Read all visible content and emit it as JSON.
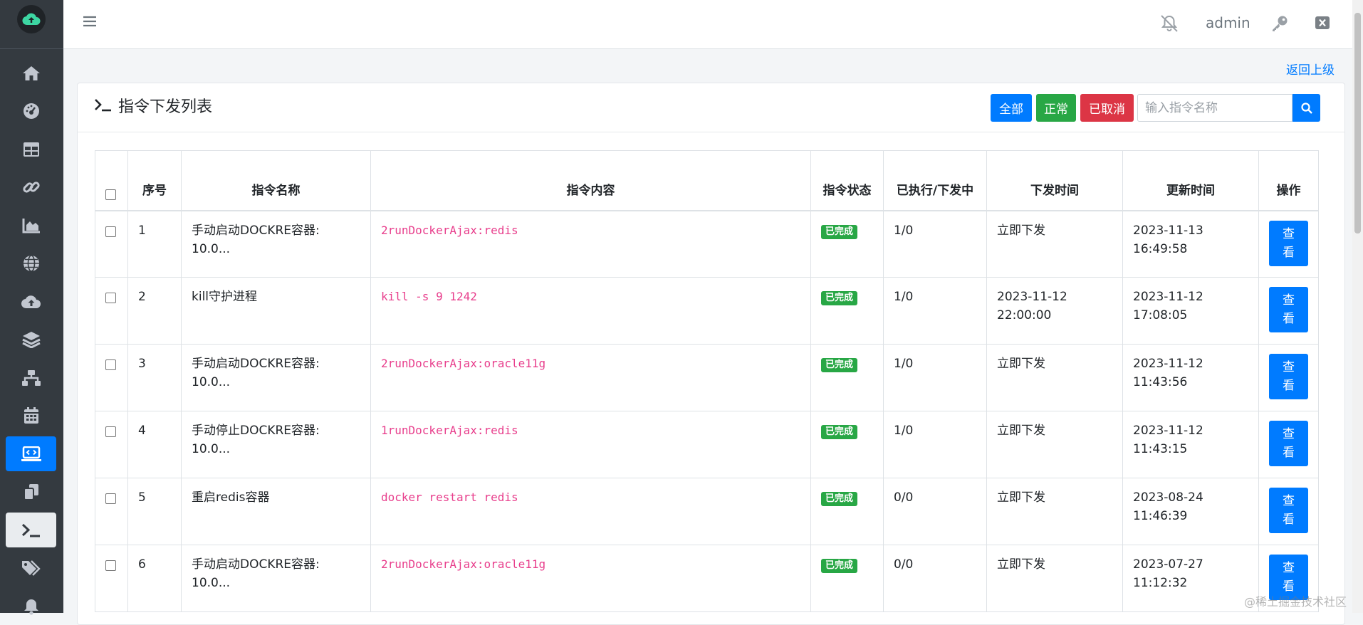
{
  "topbar": {
    "user": "admin"
  },
  "back_link": "返回上级",
  "card": {
    "title": "指令下发列表",
    "filters": {
      "all": "全部",
      "normal": "正常",
      "cancelled": "已取消"
    },
    "search_placeholder": "输入指令名称"
  },
  "table": {
    "headers": {
      "index": "序号",
      "name": "指令名称",
      "content": "指令内容",
      "status": "指令状态",
      "executed": "已执行/下发中",
      "send_time": "下发时间",
      "update_time": "更新时间",
      "action": "操作"
    },
    "rows": [
      {
        "index": "1",
        "name_l1": "手动启动DOCKRE容器:",
        "name_l2": "10.0...",
        "content": "2runDockerAjax:redis",
        "status": "已完成",
        "executed": "1/0",
        "send_l1": "立即下发",
        "send_l2": "",
        "upd_l1": "2023-11-13",
        "upd_l2": "16:49:58",
        "btn_l1": "查",
        "btn_l2": "看"
      },
      {
        "index": "2",
        "name_l1": "kill守护进程",
        "name_l2": "",
        "content": "kill -s 9 1242",
        "status": "已完成",
        "executed": "1/0",
        "send_l1": "2023-11-12",
        "send_l2": "22:00:00",
        "upd_l1": "2023-11-12",
        "upd_l2": "17:08:05",
        "btn_l1": "查",
        "btn_l2": "看"
      },
      {
        "index": "3",
        "name_l1": "手动启动DOCKRE容器:",
        "name_l2": "10.0...",
        "content": "2runDockerAjax:oracle11g",
        "status": "已完成",
        "executed": "1/0",
        "send_l1": "立即下发",
        "send_l2": "",
        "upd_l1": "2023-11-12",
        "upd_l2": "11:43:56",
        "btn_l1": "查",
        "btn_l2": "看"
      },
      {
        "index": "4",
        "name_l1": "手动停止DOCKRE容器:",
        "name_l2": "10.0...",
        "content": "1runDockerAjax:redis",
        "status": "已完成",
        "executed": "1/0",
        "send_l1": "立即下发",
        "send_l2": "",
        "upd_l1": "2023-11-12",
        "upd_l2": "11:43:15",
        "btn_l1": "查",
        "btn_l2": "看"
      },
      {
        "index": "5",
        "name_l1": "重启redis容器",
        "name_l2": "",
        "content": "docker restart redis",
        "status": "已完成",
        "executed": "0/0",
        "send_l1": "立即下发",
        "send_l2": "",
        "upd_l1": "2023-08-24",
        "upd_l2": "11:46:39",
        "btn_l1": "查",
        "btn_l2": "看"
      },
      {
        "index": "6",
        "name_l1": "手动启动DOCKRE容器:",
        "name_l2": "10.0...",
        "content": "2runDockerAjax:oracle11g",
        "status": "已完成",
        "executed": "0/0",
        "send_l1": "立即下发",
        "send_l2": "",
        "upd_l1": "2023-07-27",
        "upd_l2": "11:12:32",
        "btn_l1": "查",
        "btn_l2": "看"
      }
    ]
  },
  "watermark": "@稀土掘金技术社区",
  "colors": {
    "sidebar": "#343a40",
    "primary": "#007bff",
    "success": "#28a745",
    "danger": "#dc3545",
    "code": "#e83e8c"
  },
  "icons": [
    "cloud-upload-icon",
    "home-icon",
    "dashboard-icon",
    "table-icon",
    "link-icon",
    "chart-area-icon",
    "globe-icon",
    "cloud-upload-icon",
    "layers-icon",
    "sitemap-icon",
    "calendar-icon",
    "laptop-code-icon",
    "copy-icon",
    "terminal-icon",
    "tags-icon",
    "bell-icon",
    "bars-icon",
    "bell-slash-icon",
    "key-icon",
    "close-box-icon",
    "search-icon"
  ]
}
